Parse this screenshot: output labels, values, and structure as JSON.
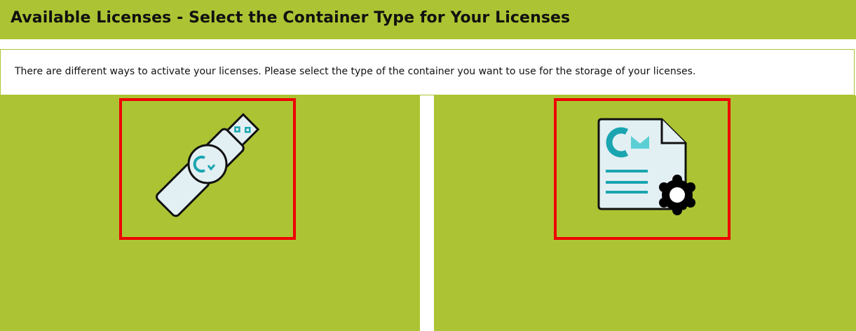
{
  "header": {
    "title": "Available Licenses - Select the Container Type for Your Licenses"
  },
  "description": {
    "text": "There are different ways to activate your licenses. Please select the type of the container you want to use for the storage of your licenses."
  },
  "options": [
    {
      "icon": "usb-dongle-icon"
    },
    {
      "icon": "license-file-icon"
    }
  ],
  "colors": {
    "accent": "#acc433",
    "selection_border": "#ee0000",
    "icon_fill": "#e2f0f3",
    "icon_brand": "#1aa5b0"
  }
}
